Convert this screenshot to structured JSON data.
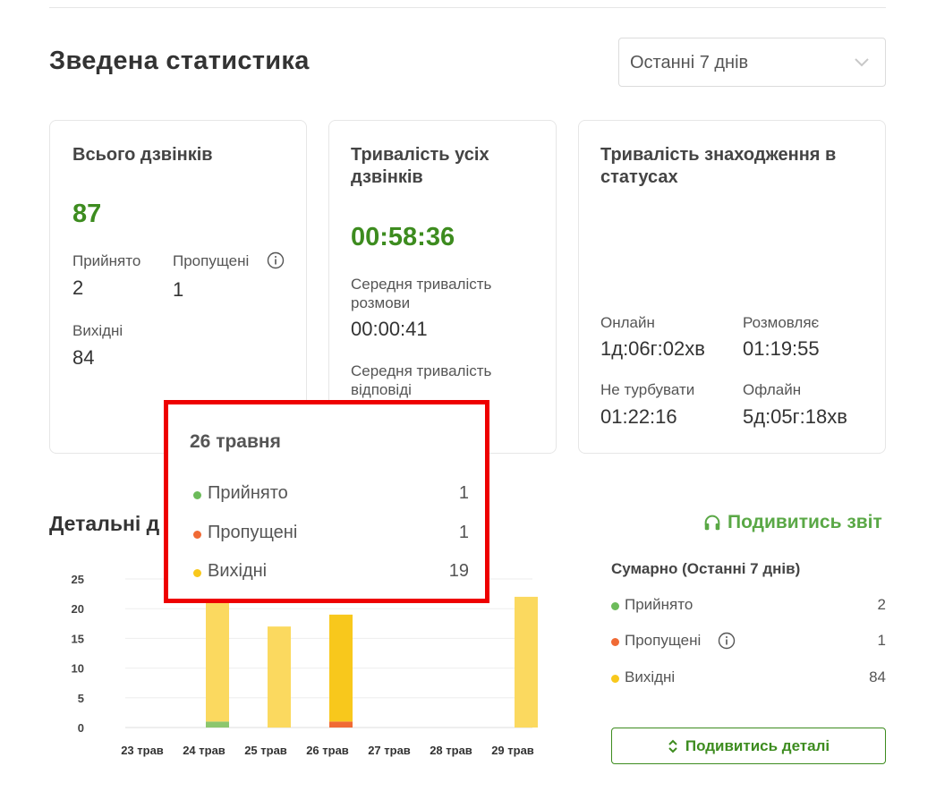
{
  "header": {
    "title": "Зведена статистика",
    "period": "Останні 7 днів"
  },
  "cards": {
    "calls": {
      "title": "Всього дзвінків",
      "total": "87",
      "accepted_label": "Прийнято",
      "accepted": "2",
      "missed_label": "Пропущені",
      "missed": "1",
      "outgoing_label": "Вихідні",
      "outgoing": "84"
    },
    "duration": {
      "title_line1": "Тривалість усіх",
      "title_line2": "дзвінків",
      "total": "00:58:36",
      "avg_talk_line1": "Середня тривалість",
      "avg_talk_line2": "розмови",
      "avg_talk": "00:00:41",
      "avg_answer_line1": "Середня тривалість",
      "avg_answer_line2": "відповіді"
    },
    "statuses": {
      "title_line1": "Тривалість знаходження в",
      "title_line2": "статусах",
      "online_label": "Онлайн",
      "online": "1д:06г:02хв",
      "talking_label": "Розмовляє",
      "talking": "01:19:55",
      "dnd_label": "Не турбувати",
      "dnd": "01:22:16",
      "offline_label": "Офлайн",
      "offline": "5д:05г:18хв"
    }
  },
  "details": {
    "title": "Детальні д",
    "report_link": "Подивитись звіт",
    "summary_title": "Сумарно (Останні 7 днів)",
    "summary": [
      {
        "label": "Прийнято",
        "value": "2",
        "color": "#6cbb5a"
      },
      {
        "label": "Пропущені",
        "value": "1",
        "color": "#f06a35"
      },
      {
        "label": "Вихідні",
        "value": "84",
        "color": "#f8c81c"
      }
    ],
    "details_button": "Подивитись деталі"
  },
  "tooltip": {
    "date": "26 травня",
    "rows": [
      {
        "label": "Прийнято",
        "value": "1",
        "color": "#6cbb5a"
      },
      {
        "label": "Пропущені",
        "value": "1",
        "color": "#f06a35"
      },
      {
        "label": "Вихідні",
        "value": "19",
        "color": "#f8c81c"
      }
    ]
  },
  "chart_data": {
    "type": "bar",
    "stacked": true,
    "categories": [
      "23 трав",
      "24 трав",
      "25 трав",
      "26 трав",
      "27 трав",
      "28 трав",
      "29 трав"
    ],
    "series": [
      {
        "name": "Прийнято",
        "color": "#8cc66e",
        "values": [
          0,
          1,
          0,
          0,
          0,
          0,
          0
        ]
      },
      {
        "name": "Пропущені",
        "color": "#f06a35",
        "values": [
          0,
          0,
          0,
          1,
          0,
          0,
          0
        ]
      },
      {
        "name": "Вихідні",
        "color": "#fbd95f",
        "values": [
          0,
          21,
          17,
          18,
          0,
          0,
          22
        ]
      }
    ],
    "highlight_index": 3,
    "highlight_color": "#f8c81c",
    "yticks": [
      0,
      5,
      10,
      15,
      20,
      25
    ],
    "ylim": [
      0,
      25
    ],
    "grid": true
  }
}
